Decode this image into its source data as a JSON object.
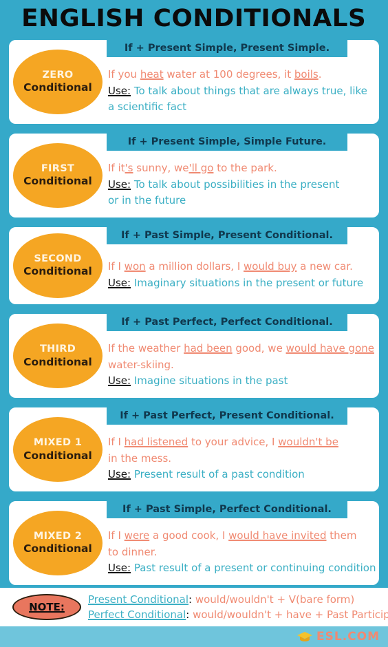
{
  "title": "ENGLISH CONDITIONALS",
  "colors": {
    "teal": "#35A9C9",
    "teal_light": "#6FC5DC",
    "orange": "#F5A623",
    "salmon": "#F08A72",
    "note_fill": "#E8765E",
    "navy": "#10384d"
  },
  "use_label": "Use:",
  "cards": [
    {
      "badge_top": "ZERO",
      "badge_bottom": "Conditional",
      "formula": "If + Present Simple, Present Simple.",
      "example_pre": "If you ",
      "example_u1": "heat",
      "example_mid": " water at 100 degrees, it ",
      "example_u2": "boils",
      "example_post": ".",
      "example_line2": "",
      "use_text": " To talk about things that are always true, like",
      "use_text2": "a scientific fact"
    },
    {
      "badge_top": "FIRST",
      "badge_bottom": "Conditional",
      "formula": "If + Present Simple, Simple Future.",
      "example_pre": "If it",
      "example_u1": "'s",
      "example_mid": " sunny, we",
      "example_u2": "'ll go",
      "example_post": " to the park.",
      "example_line2": "",
      "use_text": " To talk about possibilities in the present",
      "use_text2": "or in the future"
    },
    {
      "badge_top": "SECOND",
      "badge_bottom": "Conditional",
      "formula": "If + Past Simple, Present Conditional.",
      "example_pre": "If I ",
      "example_u1": "won",
      "example_mid": " a million dollars, I ",
      "example_u2": "would buy",
      "example_post": " a new car.",
      "example_line2": "",
      "use_text": " Imaginary situations in the present or future",
      "use_text2": ""
    },
    {
      "badge_top": "THIRD",
      "badge_bottom": "Conditional",
      "formula": "If + Past Perfect, Perfect Conditional.",
      "example_pre": "If the weather ",
      "example_u1": "had been",
      "example_mid": " good, we ",
      "example_u2": "would have gone",
      "example_post": "",
      "example_line2": "water-skiing.",
      "use_text": " Imagine situations in the past",
      "use_text2": ""
    },
    {
      "badge_top": "MIXED 1",
      "badge_bottom": "Conditional",
      "formula": "If + Past Perfect, Present Conditional.",
      "example_pre": "If I ",
      "example_u1": "had listened",
      "example_mid": " to your advice, I ",
      "example_u2": "wouldn't be",
      "example_post": "",
      "example_line2": "in the mess.",
      "use_text": " Present result of a past condition",
      "use_text2": ""
    },
    {
      "badge_top": "MIXED 2",
      "badge_bottom": "Conditional",
      "formula": "If + Past Simple, Perfect Conditional.",
      "example_pre": "If I ",
      "example_u1": "were",
      "example_mid": " a good cook, I ",
      "example_u2": "would have invited",
      "example_post": " them",
      "example_line2": "to dinner.",
      "use_text": " Past result of a present or continuing condition",
      "use_text2": ""
    }
  ],
  "note": {
    "badge": "NOTE:",
    "lines": [
      {
        "key": "Present Conditional",
        "colon": ":",
        "value": " would/wouldn't + V(bare form)"
      },
      {
        "key": "Perfect Conditional",
        "colon": ":",
        "value": " would/wouldn't + have + Past Participle"
      }
    ]
  },
  "footer": {
    "icon": "graduation-cap-icon",
    "brand": "ESL.COM"
  }
}
